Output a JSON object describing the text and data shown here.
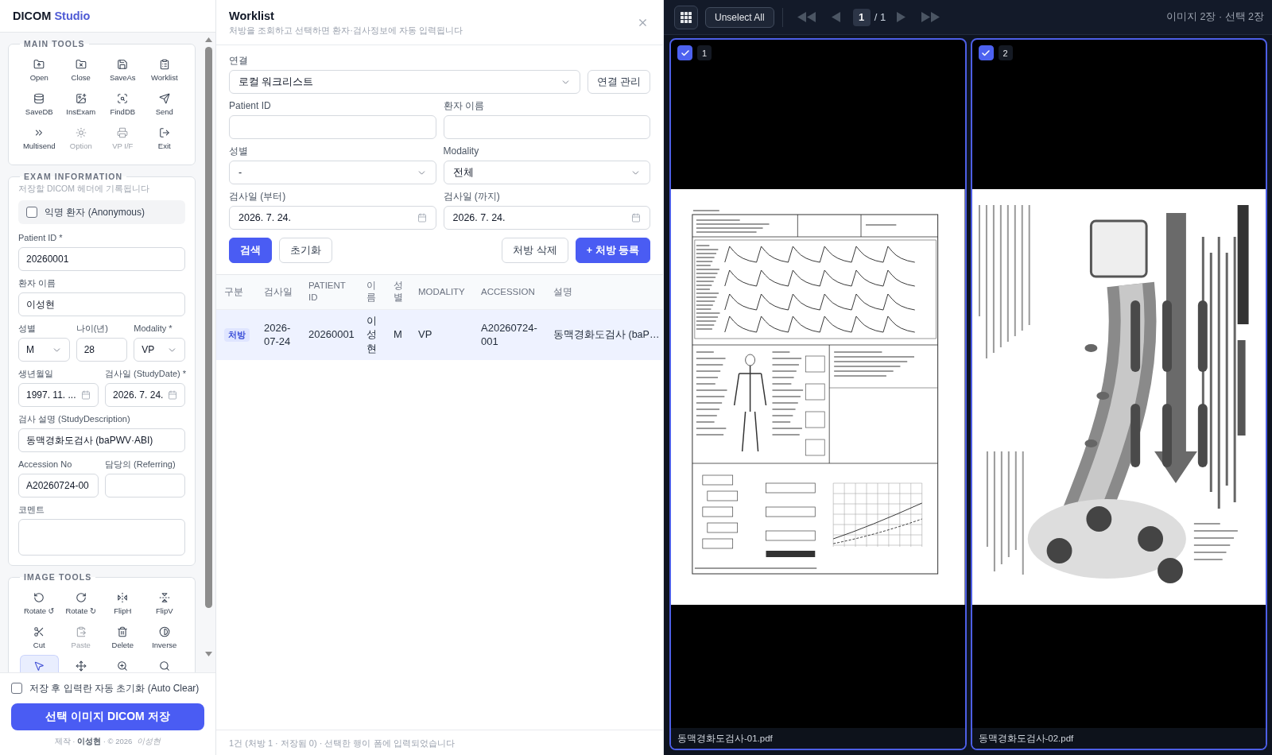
{
  "app": {
    "name": "DICOM",
    "name_accent": "Studio"
  },
  "main_tools": {
    "title": "MAIN TOOLS",
    "items": [
      {
        "label": "Open",
        "disabled": false
      },
      {
        "label": "Close",
        "disabled": false
      },
      {
        "label": "SaveAs",
        "disabled": false
      },
      {
        "label": "Worklist",
        "disabled": false
      },
      {
        "label": "SaveDB",
        "disabled": false
      },
      {
        "label": "InsExam",
        "disabled": false
      },
      {
        "label": "FindDB",
        "disabled": false
      },
      {
        "label": "Send",
        "disabled": false
      },
      {
        "label": "Multisend",
        "disabled": false
      },
      {
        "label": "Option",
        "disabled": true
      },
      {
        "label": "VP I/F",
        "disabled": true
      },
      {
        "label": "Exit",
        "disabled": false
      }
    ]
  },
  "exam_information": {
    "title": "EXAM INFORMATION",
    "note": "저장할 DICOM 헤더에 기록됩니다",
    "anonymous": {
      "label": "익명 환자 (Anonymous)",
      "checked": false
    },
    "rows": [
      {
        "fields": [
          {
            "label": "Patient ID *",
            "kind": "text",
            "value": "20260001"
          }
        ]
      },
      {
        "fields": [
          {
            "label": "환자 이름",
            "kind": "text",
            "value": "이성현"
          }
        ]
      },
      {
        "fields": [
          {
            "label": "성별",
            "kind": "select",
            "value": "M"
          },
          {
            "label": "나이(년)",
            "kind": "text",
            "value": "28"
          },
          {
            "label": "Modality *",
            "kind": "select",
            "value": "VP"
          }
        ]
      },
      {
        "fields": [
          {
            "label": "생년월일",
            "kind": "date",
            "value": "1997. 11. ..."
          },
          {
            "label": "검사일 (StudyDate) *",
            "kind": "date",
            "value": "2026. 7. 24."
          }
        ]
      },
      {
        "fields": [
          {
            "label": "검사 설명 (StudyDescription)",
            "kind": "text",
            "value": "동맥경화도검사 (baPWV·ABI)"
          }
        ]
      },
      {
        "fields": [
          {
            "label": "Accession No",
            "kind": "text",
            "value": "A20260724-00"
          },
          {
            "label": "담당의 (Referring)",
            "kind": "text"
          }
        ]
      },
      {
        "fields": [
          {
            "label": "코멘트",
            "kind": "textarea"
          }
        ]
      }
    ]
  },
  "image_tools": {
    "title": "IMAGE TOOLS",
    "items": [
      {
        "label": "Rotate ↺",
        "disabled": false,
        "selected": false
      },
      {
        "label": "Rotate ↻",
        "disabled": false,
        "selected": false
      },
      {
        "label": "FlipH",
        "disabled": false,
        "selected": false
      },
      {
        "label": "FlipV",
        "disabled": false,
        "selected": false
      },
      {
        "label": "Cut",
        "disabled": false,
        "selected": false
      },
      {
        "label": "Paste",
        "disabled": true,
        "selected": false
      },
      {
        "label": "Delete",
        "disabled": false,
        "selected": false
      },
      {
        "label": "Inverse",
        "disabled": false,
        "selected": false
      },
      {
        "disabled": false,
        "selected": true
      },
      {
        "disabled": false,
        "selected": false
      },
      {
        "disabled": false,
        "selected": false
      },
      {
        "disabled": false,
        "selected": false
      }
    ]
  },
  "save_panel": {
    "auto_clear": {
      "label": "저장 후 입력란 자동 초기화 (Auto Clear)",
      "checked": false
    },
    "save_button": "선택 이미지 DICOM 저장",
    "credit": "제작 · **이성현** · © 2026",
    "signature": "이성현"
  },
  "worklist": {
    "title": "Worklist",
    "subtitle": "처방을 조회하고 선택하면 환자·검사정보에 자동 입력됩니다",
    "connection": {
      "label": "연결",
      "kind": "select",
      "value": "로컬 워크리스트",
      "manage_button": "연결 관리"
    },
    "filters": [
      {
        "label": "Patient ID",
        "kind": "text"
      },
      {
        "label": "환자 이름",
        "kind": "text"
      },
      {
        "label": "성별",
        "kind": "select",
        "value": "-"
      },
      {
        "label": "Modality",
        "kind": "select",
        "value": "전체"
      },
      {
        "label": "검사일 (부터)",
        "kind": "date",
        "value": "2026. 7. 24."
      },
      {
        "label": "검사일 (까지)",
        "kind": "date",
        "value": "2026. 7. 24."
      }
    ],
    "left_actions": [
      {
        "label": "검색",
        "kind": "primary"
      },
      {
        "label": "초기화",
        "kind": "secondary"
      }
    ],
    "right_actions": [
      {
        "label": "처방 삭제",
        "kind": "secondary"
      },
      {
        "label": "+ 처방 등록",
        "kind": "primary"
      }
    ],
    "table": {
      "columns": [
        "구분",
        "검사일",
        "PATIENT ID",
        "이름",
        "성별",
        "MODALITY",
        "ACCESSION",
        "설명"
      ],
      "rows": [
        {
          "selected": true,
          "cells": [
            {
              "kind": "tag",
              "text": "처방"
            },
            {
              "kind": "text",
              "text": "2026-07-24"
            },
            {
              "kind": "text",
              "text": "20260001"
            },
            {
              "kind": "text",
              "text": "이성현"
            },
            {
              "kind": "text",
              "text": "M"
            },
            {
              "kind": "text",
              "text": "VP"
            },
            {
              "kind": "text",
              "text": "A20260724-001"
            },
            {
              "kind": "text",
              "text": "동맥경화도검사 (baP…"
            }
          ]
        }
      ]
    },
    "status": "1건 (처방 1 · 저장됨 0) · 선택한 행이 폼에 입력되었습니다"
  },
  "viewer": {
    "unselect_button": "Unselect All",
    "nav": [
      {
        "kind": "first",
        "disabled": true
      },
      {
        "kind": "prev",
        "disabled": true
      },
      {
        "kind": "next",
        "disabled": true
      },
      {
        "kind": "last",
        "disabled": true
      }
    ],
    "page": {
      "current": "1",
      "total": "/ 1"
    },
    "summary": "이미지 2장 · 선택 2장",
    "images": [
      {
        "number": "1",
        "checked": true,
        "kind": "report",
        "filename": "동맥경화도검사-01.pdf"
      },
      {
        "number": "2",
        "checked": true,
        "kind": "leaflet",
        "filename": "동맥경화도검사-02.pdf"
      }
    ]
  }
}
